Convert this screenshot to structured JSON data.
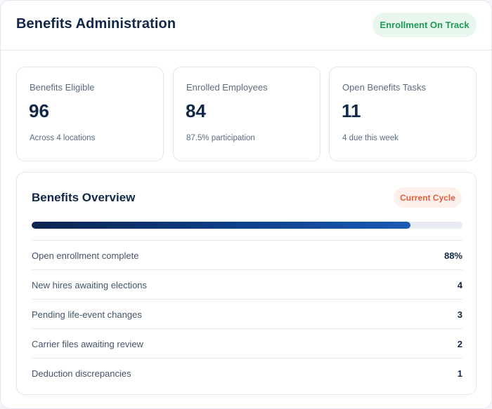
{
  "header": {
    "title": "Benefits Administration",
    "status_badge": "Enrollment On Track"
  },
  "stats": [
    {
      "label": "Benefits Eligible",
      "value": "96",
      "note": "Across 4 locations"
    },
    {
      "label": "Enrolled Employees",
      "value": "84",
      "note": "87.5% participation"
    },
    {
      "label": "Open Benefits Tasks",
      "value": "11",
      "note": "4 due this week"
    }
  ],
  "overview": {
    "title": "Benefits Overview",
    "badge": "Current Cycle",
    "progress_percent": 88,
    "rows": [
      {
        "label": "Open enrollment complete",
        "value": "88%"
      },
      {
        "label": "New hires awaiting elections",
        "value": "4"
      },
      {
        "label": "Pending life-event changes",
        "value": "3"
      },
      {
        "label": "Carrier files awaiting review",
        "value": "2"
      },
      {
        "label": "Deduction discrepancies",
        "value": "1"
      }
    ]
  },
  "colors": {
    "title": "#12284a",
    "success": "#1e9a55",
    "accent_warm": "#e0603a",
    "progress_start": "#0d2550",
    "progress_end": "#1a5bb5"
  }
}
